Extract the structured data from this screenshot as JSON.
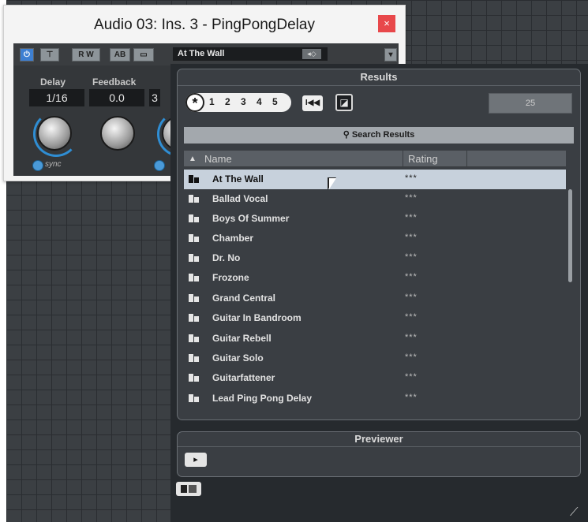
{
  "plugin": {
    "title": "Audio 03: Ins. 3 - PingPongDelay",
    "close_label": "×",
    "toolbar": {
      "rw_label": "R W",
      "preset": "At The Wall"
    },
    "params": [
      {
        "label": "Delay",
        "value": "1/16"
      },
      {
        "label": "Feedback",
        "value": "0.0"
      },
      {
        "label": "",
        "value": "3"
      }
    ],
    "sync_label": "sync"
  },
  "results": {
    "header": "Results",
    "rating_filter": [
      "*",
      "1",
      "2",
      "3",
      "4",
      "5"
    ],
    "skip_label": "I◀◀",
    "count": "25",
    "search_label": "Search Results",
    "columns": {
      "name": "Name",
      "rating": "Rating"
    },
    "rows": [
      {
        "name": "At The Wall",
        "rating": "***",
        "selected": true
      },
      {
        "name": "Ballad Vocal",
        "rating": "***"
      },
      {
        "name": "Boys Of Summer",
        "rating": "***"
      },
      {
        "name": "Chamber",
        "rating": "***"
      },
      {
        "name": "Dr. No",
        "rating": "***"
      },
      {
        "name": "Frozone",
        "rating": "***"
      },
      {
        "name": "Grand Central",
        "rating": "***"
      },
      {
        "name": "Guitar In Bandroom",
        "rating": "***"
      },
      {
        "name": "Guitar Rebell",
        "rating": "***"
      },
      {
        "name": "Guitar Solo",
        "rating": "***"
      },
      {
        "name": "Guitarfattener",
        "rating": "***"
      },
      {
        "name": "Lead Ping Pong Delay",
        "rating": "***"
      }
    ]
  },
  "previewer": {
    "header": "Previewer"
  },
  "icons": {
    "power": "power-icon",
    "star": "star-icon",
    "search": "search-icon",
    "sort": "sort-ascending-icon",
    "preset": "preset-icon",
    "play": "play-icon",
    "layout": "layout-icon",
    "resize": "resize-grip-icon"
  },
  "colors": {
    "accent": "#3d7fd2",
    "close": "#e8484b",
    "selected_row": "#c7d1dc"
  }
}
